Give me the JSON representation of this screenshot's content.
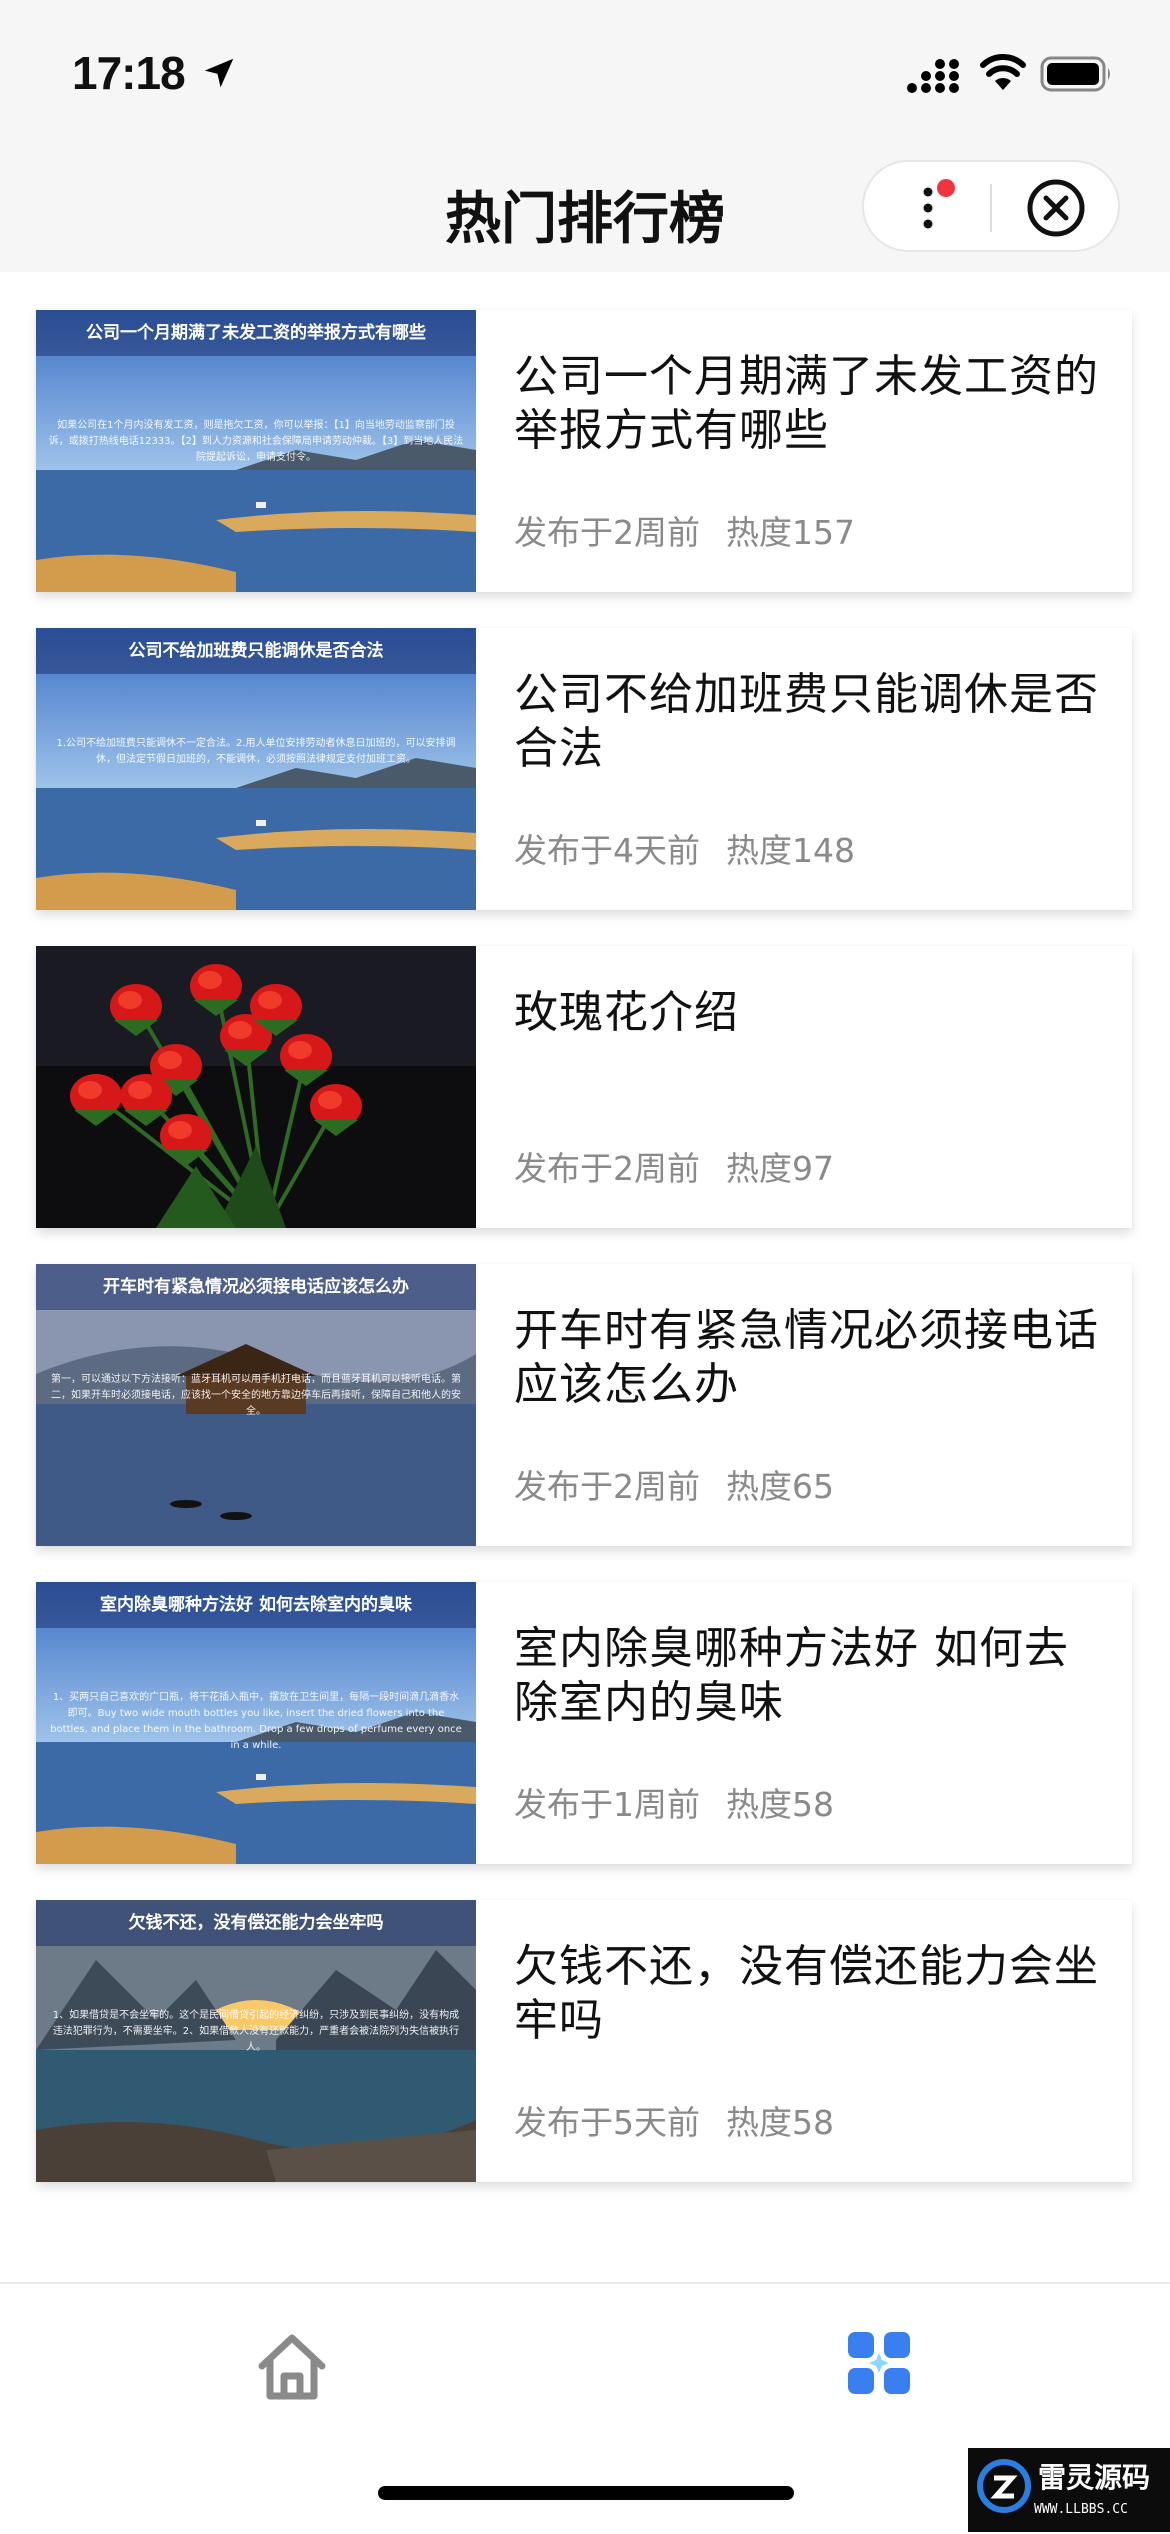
{
  "status_bar": {
    "time": "17:18",
    "icons": [
      "location-arrow-icon",
      "cellular-signal-icon",
      "wifi-icon",
      "battery-icon"
    ]
  },
  "nav": {
    "title": "热门排行榜",
    "capsule_icons": [
      "more-icon",
      "close-icon"
    ],
    "badge_color": "#f0353d"
  },
  "articles": [
    {
      "title": "公司一个月期满了未发工资的举报方式有哪些",
      "time": "发布于2周前",
      "heat": "热度157",
      "thumb_title": "公司一个月期满了未发工资的举报方式有哪些",
      "thumb_text": "如果公司在1个月内没有发工资，则是拖欠工资，你可以举报：【1】向当地劳动监察部门投诉，或拨打热线电话12333。【2】到人力资源和社会保障局申请劳动仲裁。【3】到当地人民法院提起诉讼，申请支付令。",
      "thumb_type": "lake"
    },
    {
      "title": "公司不给加班费只能调休是否合法",
      "time": "发布于4天前",
      "heat": "热度148",
      "thumb_title": "公司不给加班费只能调休是否合法",
      "thumb_text": "1.公司不给加班费只能调休不一定合法。2.用人单位安排劳动者休息日加班的，可以安排调休，但法定节假日加班的，不能调休，必须按照法律规定支付加班工资。",
      "thumb_type": "lake"
    },
    {
      "title": "玫瑰花介绍",
      "time": "发布于2周前",
      "heat": "热度97",
      "thumb_title": "",
      "thumb_text": "",
      "thumb_type": "roses"
    },
    {
      "title": "开车时有紧急情况必须接电话应该怎么办",
      "time": "发布于2周前",
      "heat": "热度65",
      "thumb_title": "开车时有紧急情况必须接电话应该怎么办",
      "thumb_text": "第一，可以通过以下方法接听：蓝牙耳机可以用手机打电话，而且蓝牙耳机可以接听电话。第二，如果开车时必须接电话，应该找一个安全的地方靠边停车后再接听，保障自己和他人的安全。",
      "thumb_type": "village"
    },
    {
      "title": "室内除臭哪种方法好 如何去除室内的臭味",
      "time": "发布于1周前",
      "heat": "热度58",
      "thumb_title": "室内除臭哪种方法好 如何去除室内的臭味",
      "thumb_text": "1、买两只自己喜欢的广口瓶，将干花插入瓶中，摆放在卫生间里，每隔一段时间滴几滴香水即可。Buy two wide mouth bottles you like, insert the dried flowers into the bottles, and place them in the bathroom. Drop a few drops of perfume every once in a while.",
      "thumb_type": "lake"
    },
    {
      "title": "欠钱不还，没有偿还能力会坐牢吗",
      "time": "发布于5天前",
      "heat": "热度58",
      "thumb_title": "欠钱不还，没有偿还能力会坐牢吗",
      "thumb_text": "1、如果借贷是不会坐牢的。这个是民间借贷引起的经济纠纷，只涉及到民事纠纷，没有构成违法犯罪行为，不需要坐牢。2、如果借款人没有还款能力，严重者会被法院列为失信被执行人。",
      "thumb_type": "mountain"
    }
  ],
  "tab_bar": {
    "items": [
      "home-icon",
      "apps-icon"
    ],
    "active_color": "#3a7ff0",
    "inactive_color": "#8a8a8a"
  },
  "watermark": {
    "name": "雷灵源码",
    "url": "WWW.LLBBS.CC"
  }
}
